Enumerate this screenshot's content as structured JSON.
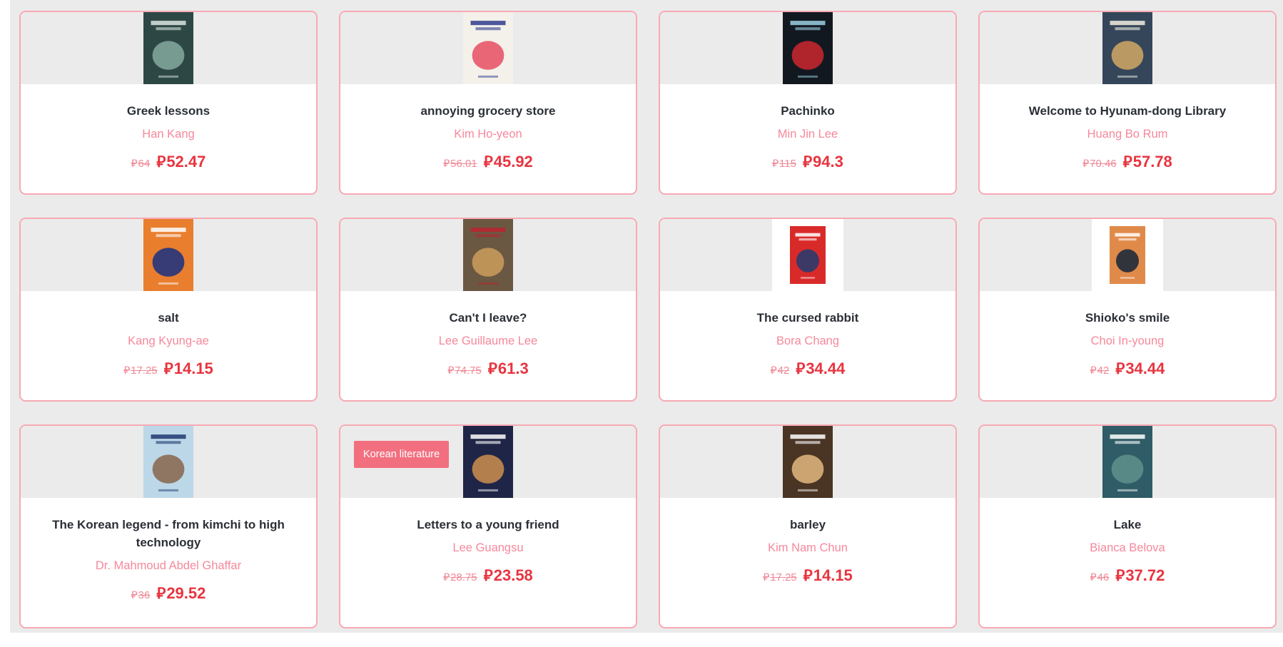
{
  "currency_symbol": "⃁",
  "books": [
    {
      "title": "Greek lessons",
      "author": "Han Kang",
      "old_price": "64",
      "price": "52.47",
      "cover": {
        "bg": "#2d4844",
        "accent": "#7fa39a",
        "title_color": "#d9e6e0"
      }
    },
    {
      "title": "annoying grocery store",
      "author": "Kim Ho-yeon",
      "old_price": "56.01",
      "price": "45.92",
      "cover": {
        "bg": "#f3f1ea",
        "accent": "#e8566a",
        "title_color": "#2e3b8c"
      }
    },
    {
      "title": "Pachinko",
      "author": "Min Jin Lee",
      "old_price": "115",
      "price": "94.3",
      "cover": {
        "bg": "#121820",
        "accent": "#c2262e",
        "title_color": "#9ad0e4"
      }
    },
    {
      "title": "Welcome to Hyunam-dong Library",
      "author": "Huang Bo Rum",
      "old_price": "70.46",
      "price": "57.78",
      "cover": {
        "bg": "#35465a",
        "accent": "#c9a263",
        "title_color": "#f2efe2"
      }
    },
    {
      "title": "salt",
      "author": "Kang Kyung-ae",
      "old_price": "17.25",
      "price": "14.15",
      "cover": {
        "bg": "#e87e2e",
        "accent": "#24347e",
        "title_color": "#ffffff"
      }
    },
    {
      "title": "Can't I leave?",
      "author": "Lee Guillaume Lee",
      "old_price": "74.75",
      "price": "61.3",
      "cover": {
        "bg": "#6b5843",
        "accent": "#c79a5b",
        "title_color": "#b8242e"
      }
    },
    {
      "title": "The cursed rabbit",
      "author": "Bora Chang",
      "old_price": "42",
      "price": "34.44",
      "cover": {
        "bg": "#d92a2a",
        "accent": "#2a3b6e",
        "title_color": "#ffffff"
      }
    },
    {
      "title": "Shioko's smile",
      "author": "Choi In-young",
      "old_price": "42",
      "price": "34.44",
      "cover": {
        "bg": "#e08a4a",
        "accent": "#1f2a3a",
        "title_color": "#ffffff"
      }
    },
    {
      "title": "The Korean legend - from kimchi to high technology",
      "author": "Dr. Mahmoud Abdel Ghaffar",
      "old_price": "36",
      "price": "29.52",
      "cover": {
        "bg": "#bcd8e8",
        "accent": "#8a6b54",
        "title_color": "#1e3a70"
      }
    },
    {
      "title": "Letters to a young friend",
      "author": "Lee Guangsu",
      "old_price": "28.75",
      "price": "23.58",
      "badge": "Korean literature",
      "cover": {
        "bg": "#1f2547",
        "accent": "#c28a4e",
        "title_color": "#ffffff"
      }
    },
    {
      "title": "barley",
      "author": "Kim Nam Chun",
      "old_price": "17.25",
      "price": "14.15",
      "cover": {
        "bg": "#4a3424",
        "accent": "#d9b07a",
        "title_color": "#ffffff"
      }
    },
    {
      "title": "Lake",
      "author": "Bianca Belova",
      "old_price": "46",
      "price": "37.72",
      "cover": {
        "bg": "#2f5c66",
        "accent": "#5e8e8a",
        "title_color": "#ffffff"
      }
    }
  ]
}
